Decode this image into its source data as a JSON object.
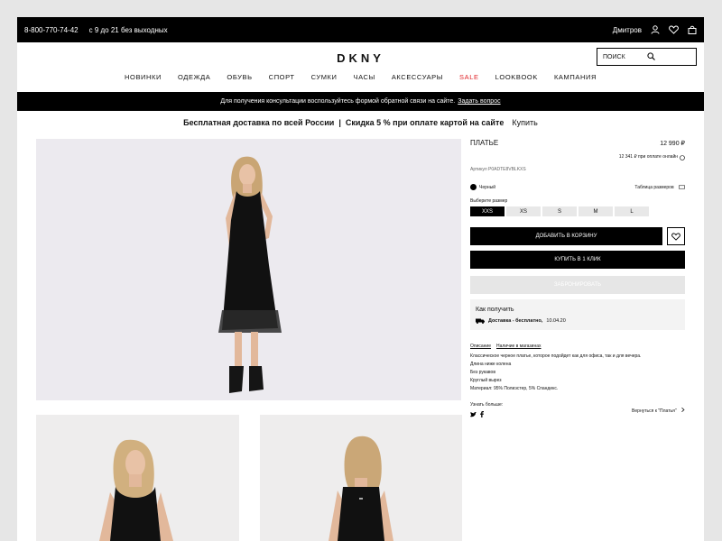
{
  "topbar": {
    "phone": "8-800-770-74-42",
    "hours": "с 9 до 21 без выходных",
    "city": "Дмитров",
    "wishlist_count": "0"
  },
  "header": {
    "logo": "DKNY",
    "search_placeholder": "ПОИСК"
  },
  "nav": {
    "items": [
      "НОВИНКИ",
      "ОДЕЖДА",
      "ОБУВЬ",
      "СПОРТ",
      "СУМКИ",
      "ЧАСЫ",
      "АКСЕССУАРЫ",
      "SALE",
      "LOOKBOOK",
      "КАМПАНИЯ"
    ]
  },
  "consult": {
    "text": "Для получения консультации воспользуйтесь формой обратной связи на сайте.",
    "link": "Задать вопрос"
  },
  "promo": {
    "left": "Бесплатная доставка по всей России",
    "sep": "|",
    "right": "Скидка 5 % при оплате картой на сайте",
    "buy": "Купить"
  },
  "product": {
    "name": "ПЛАТЬЕ",
    "price": "12 990 ₽",
    "online_price": "12 341 ₽ при оплате онлайн",
    "article": "Артикул P0ADTE8VBLKXS",
    "color": "Черный",
    "size_table": "Таблица размеров",
    "choose_size": "Выберите размер",
    "sizes": [
      "XXS",
      "XS",
      "S",
      "M",
      "L"
    ],
    "selected_size": "XXS",
    "add_to_cart": "ДОБАВИТЬ В КОРЗИНУ",
    "one_click": "КУПИТЬ В 1 КЛИК",
    "reserve": "ЗАБРОНИРОВАТЬ",
    "how_title": "Как получить",
    "delivery_label": "Доставка - бесплатно,",
    "delivery_date": "10.04.20",
    "tab_desc": "Описание",
    "tab_stores": "Наличие в магазинах",
    "description": [
      "Классическое черное платье, которое подойдет как для офиса, так и для вечера.",
      "Длина ниже колена",
      "Без рукавов",
      "Круглый вырез",
      "Материал: 95% Полиэстер, 5% Спандекс."
    ],
    "learn_more": "Узнать больше:",
    "back": "Вернуться к \"Платья\""
  },
  "colors": {
    "accent_sale": "#e0252a",
    "black": "#000000"
  }
}
